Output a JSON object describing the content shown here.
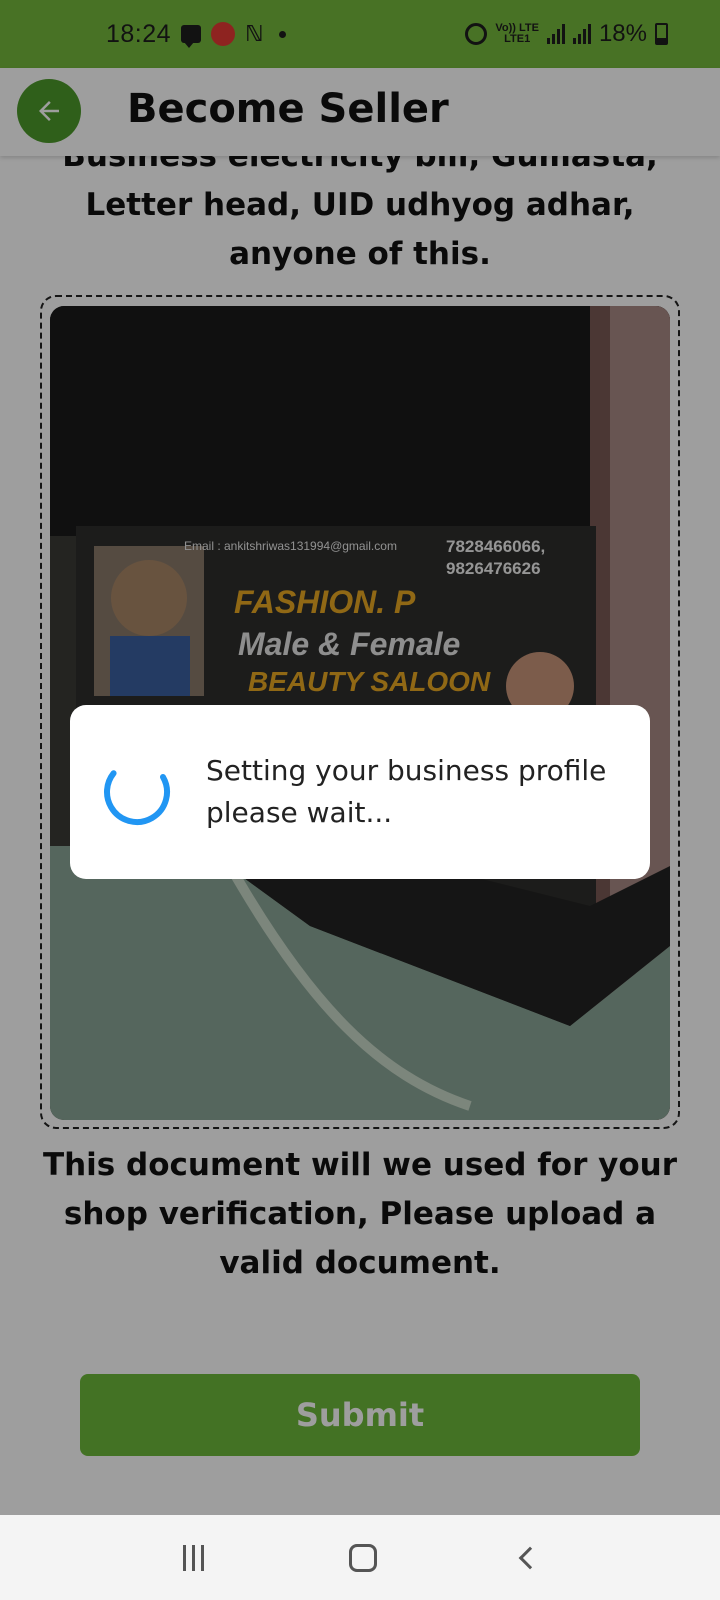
{
  "status_bar": {
    "time": "18:24",
    "network_label_top": "Vo)) LTE",
    "network_label_bottom": "LTE1",
    "battery": "18%"
  },
  "app_bar": {
    "title": "Become Seller",
    "back_icon": "arrow-left-icon"
  },
  "content": {
    "doc_description_line0": "Business electricity bill, Gumasta,",
    "doc_description_line1": "Letter head, UID udhyog adhar,",
    "doc_description_line2": "anyone of this.",
    "card": {
      "email": "Email : ankitshriwas131994@gmail.com",
      "phone1": "7828466066,",
      "phone2": "9826476626",
      "shop_name": "FASHION. P",
      "tagline": "Male & Female",
      "type": "BEAUTY SALOON"
    },
    "footer_note": "This document will we used for your shop verification, Please upload a valid document.",
    "submit_label": "Submit"
  },
  "dialog": {
    "message_line1": "Setting your business profile",
    "message_line2": "please wait..."
  },
  "colors": {
    "status_bar": "#75b83c",
    "accent": "#6cb83a",
    "back_button": "#4d9a2a",
    "spinner": "#2196f3"
  }
}
